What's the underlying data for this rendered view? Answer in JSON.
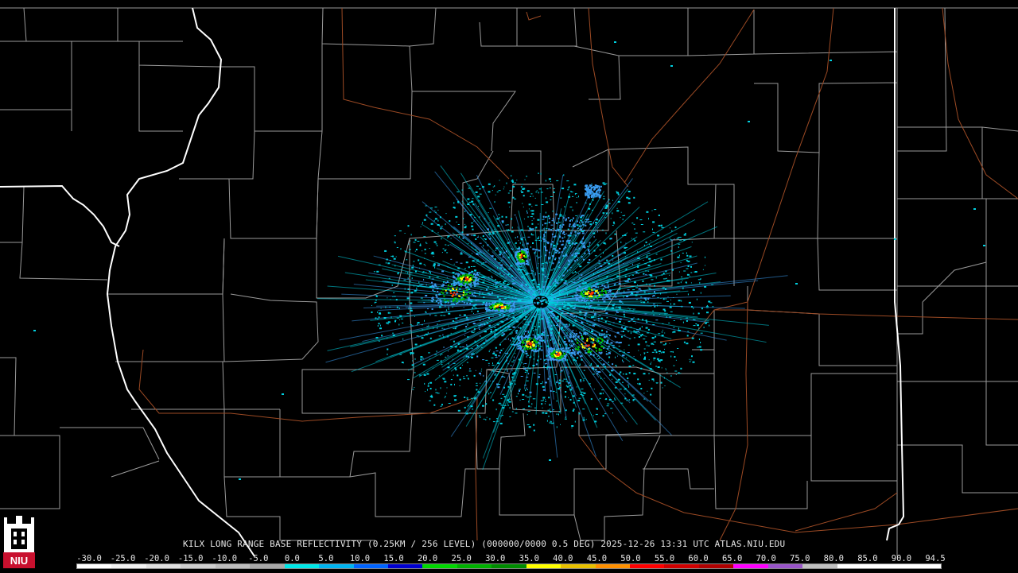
{
  "product": {
    "caption": "KILX LONG RANGE BASE REFLECTIVITY (0.25KM / 256 LEVEL) (000000/0000 0.5 DEG) 2025-12-26 13:31 UTC  ATLAS.NIU.EDU"
  },
  "logo": {
    "text": "NIU",
    "color": "#c8102e"
  },
  "colorscale": {
    "labels": [
      "-30.0",
      "-25.0",
      "-20.0",
      "-15.0",
      "-10.0",
      "-5.0",
      "0.0",
      "5.0",
      "10.0",
      "15.0",
      "20.0",
      "25.0",
      "30.0",
      "35.0",
      "40.0",
      "45.0",
      "50.0",
      "55.0",
      "60.0",
      "65.0",
      "70.0",
      "75.0",
      "80.0",
      "85.0",
      "90.0",
      "94.5"
    ],
    "colors": [
      "#ffffff",
      "#f2f2f2",
      "#e0e0e0",
      "#cfcfcf",
      "#bdbdbd",
      "#a8a8a8",
      "#00e8e8",
      "#00b4f0",
      "#0064ff",
      "#0000d0",
      "#00d800",
      "#00b000",
      "#008c00",
      "#ffff00",
      "#e8c000",
      "#ff9000",
      "#ff0000",
      "#d00000",
      "#b00000",
      "#ff00ff",
      "#9954c9",
      "#c0c0c0",
      "#ffffff",
      "#ffffff",
      "#ffffff"
    ]
  },
  "colors": {
    "county_lines": "#9a9a9a",
    "state_lines": "#ffffff",
    "highways": "#9c4a24",
    "echo_light": "#00d0e0",
    "echo_mid": "#3a9cf0",
    "echo_strong": "#00c000",
    "echo_heavy": "#ffff00",
    "echo_peak": "#ff3000"
  }
}
